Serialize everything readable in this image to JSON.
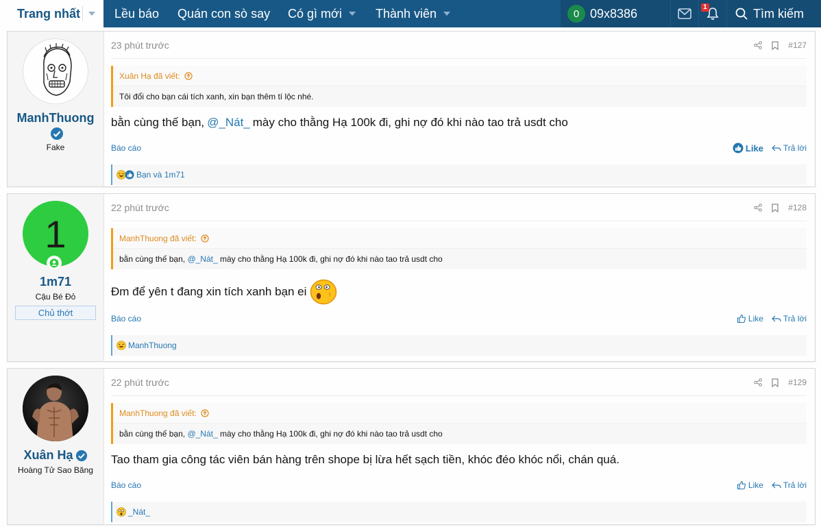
{
  "nav": {
    "home": "Trang nhất",
    "items": [
      "Lều báo",
      "Quán con sò say",
      "Có gì mới",
      "Thành viên"
    ],
    "user_count": "0",
    "username": "09x8386",
    "alert_count": "1",
    "search": "Tìm kiếm"
  },
  "posts": [
    {
      "time": "23 phút trước",
      "number": "#127",
      "user": {
        "name": "ManhThuong",
        "title": "Fake",
        "verified": true
      },
      "quote": {
        "author": "Xuân Hạ đã viết:",
        "text": "Tôi đổi cho bạn cái tích xanh, xin bạn thêm tí lộc nhé."
      },
      "message": {
        "before": "bằn cùng thế bạn,",
        "mention": "@_Nát_",
        "after": "mày cho thằng Hạ 100k đi, ghi nợ đó khi nào tao trả usdt cho"
      },
      "report": "Báo cáo",
      "like": "Like",
      "reply": "Trả lời",
      "reactions": "Bạn và 1m71"
    },
    {
      "time": "22 phút trước",
      "number": "#128",
      "user": {
        "name": "1m71",
        "title": "Cậu Bé Đỏ",
        "banner": "Chủ thớt",
        "letter": "1"
      },
      "quote": {
        "author": "ManhThuong đã viết:",
        "text_before": "bằn cùng thế bạn,",
        "mention": "@_Nát_",
        "text_after": "mày cho thằng Hạ 100k đi, ghi nợ đó khi nào tao trả usdt cho"
      },
      "message": "Đm để yên t đang xin tích xanh bạn ei",
      "report": "Báo cáo",
      "like": "Like",
      "reply": "Trả lời",
      "reactions": "ManhThuong"
    },
    {
      "time": "22 phút trước",
      "number": "#129",
      "user": {
        "name": "Xuân Hạ",
        "title": "Hoàng Tử Sao Băng",
        "verified": true
      },
      "quote": {
        "author": "ManhThuong đã viết:",
        "text_before": "bằn cùng thế bạn,",
        "mention": "@_Nát_",
        "text_after": "mày cho thằng Hạ 100k đi, ghi nợ đó khi nào tao trả usdt cho"
      },
      "message": "Tao tham gia công tác viên bán hàng trên shope bị lừa hết sạch tiền, khóc đéo khóc nổi, chán quá.",
      "report": "Báo cáo",
      "like": "Like",
      "reply": "Trả lời",
      "reactions": "_Nát_"
    }
  ],
  "colors": {
    "nav": "#185886",
    "link": "#2577b1",
    "quote_accent": "#f39c12"
  }
}
